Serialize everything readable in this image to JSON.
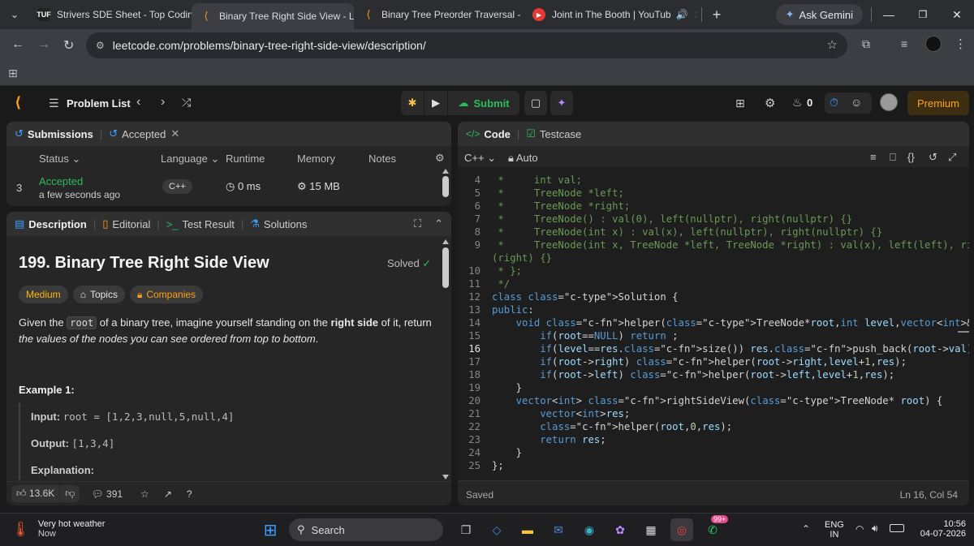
{
  "browser": {
    "tabs": [
      {
        "title": "Strivers SDE Sheet - Top Coding",
        "icon": "tuf-favicon"
      },
      {
        "title": "Binary Tree Right Side View - Le",
        "icon": "leetcode-favicon",
        "active": true
      },
      {
        "title": "Binary Tree Preorder Traversal -",
        "icon": "leetcode-favicon"
      },
      {
        "title": "Joint in The Booth | YouTub",
        "icon": "youtube-favicon"
      }
    ],
    "ask_gemini": "Ask Gemini",
    "url": "leetcode.com/problems/binary-tree-right-side-view/description/"
  },
  "nav": {
    "problem_list": "Problem List",
    "submit": "Submit",
    "streak": "0",
    "premium": "Premium"
  },
  "submissions": {
    "tab": "Submissions",
    "accepted_tab": "Accepted",
    "columns": [
      "Status",
      "Language",
      "Runtime",
      "Memory",
      "Notes"
    ],
    "row": {
      "index": "3",
      "status": "Accepted",
      "time": "a few seconds ago",
      "language": "C++",
      "runtime": "0 ms",
      "memory": "15 MB"
    }
  },
  "description": {
    "tabs": [
      "Description",
      "Editorial",
      "Test Result",
      "Solutions"
    ],
    "title": "199. Binary Tree Right Side View",
    "solved": "Solved",
    "difficulty": "Medium",
    "topics": "Topics",
    "companies": "Companies",
    "text_1": "Given the ",
    "text_code": "root",
    "text_2": " of a binary tree, imagine yourself standing on the ",
    "text_bold": "right side",
    "text_3": " of it, return ",
    "text_italic": "the values of the nodes you can see ordered from top to bottom",
    "text_4": ".",
    "example_title": "Example 1:",
    "input_label": "Input:",
    "input_value": "root = [1,2,3,null,5,null,4]",
    "output_label": "Output:",
    "output_value": "[1,3,4]",
    "explanation_label": "Explanation:",
    "likes": "13.6K",
    "comments": "391"
  },
  "editor": {
    "tab_code": "Code",
    "tab_testcase": "Testcase",
    "language": "C++",
    "mode": "Auto",
    "status": "Saved",
    "cursor": "Ln 16, Col 54",
    "current_line": 16,
    "lines": [
      {
        "n": "4",
        "t": " *     int val;",
        "k": "com"
      },
      {
        "n": "5",
        "t": " *     TreeNode *left;",
        "k": "com"
      },
      {
        "n": "6",
        "t": " *     TreeNode *right;",
        "k": "com"
      },
      {
        "n": "7",
        "t": " *     TreeNode() : val(0), left(nullptr), right(nullptr) {}",
        "k": "com"
      },
      {
        "n": "8",
        "t": " *     TreeNode(int x) : val(x), left(nullptr), right(nullptr) {}",
        "k": "com"
      },
      {
        "n": "9",
        "t": " *     TreeNode(int x, TreeNode *left, TreeNode *right) : val(x), left(left), right",
        "k": "com"
      },
      {
        "n": "",
        "t": "(right) {}",
        "k": "com"
      },
      {
        "n": "10",
        "t": " * };",
        "k": "com"
      },
      {
        "n": "11",
        "t": " */",
        "k": "com"
      },
      {
        "n": "12",
        "t": "class Solution {",
        "k": "code"
      },
      {
        "n": "13",
        "t": "public:",
        "k": "code"
      },
      {
        "n": "14",
        "t": "    void helper(TreeNode*root,int level,vector<int>&res){",
        "k": "code"
      },
      {
        "n": "15",
        "t": "        if(root==NULL) return ;",
        "k": "code"
      },
      {
        "n": "16",
        "t": "        if(level==res.size()) res.push_back(root->val);",
        "k": "code"
      },
      {
        "n": "17",
        "t": "        if(root->right) helper(root->right,level+1,res);",
        "k": "code"
      },
      {
        "n": "18",
        "t": "        if(root->left) helper(root->left,level+1,res);",
        "k": "code"
      },
      {
        "n": "19",
        "t": "    }",
        "k": "code"
      },
      {
        "n": "20",
        "t": "    vector<int> rightSideView(TreeNode* root) {",
        "k": "code"
      },
      {
        "n": "21",
        "t": "        vector<int>res;",
        "k": "code"
      },
      {
        "n": "22",
        "t": "        helper(root,0,res);",
        "k": "code"
      },
      {
        "n": "23",
        "t": "        return res;",
        "k": "code"
      },
      {
        "n": "24",
        "t": "    }",
        "k": "code"
      },
      {
        "n": "25",
        "t": "};",
        "k": "code"
      }
    ]
  },
  "taskbar": {
    "weather_title": "Very hot weather",
    "weather_sub": "Now",
    "search": "Search",
    "badge": "99+",
    "lang": "ENG",
    "lang_sub": "IN",
    "time": "10:56",
    "date": "04-07-2026"
  }
}
